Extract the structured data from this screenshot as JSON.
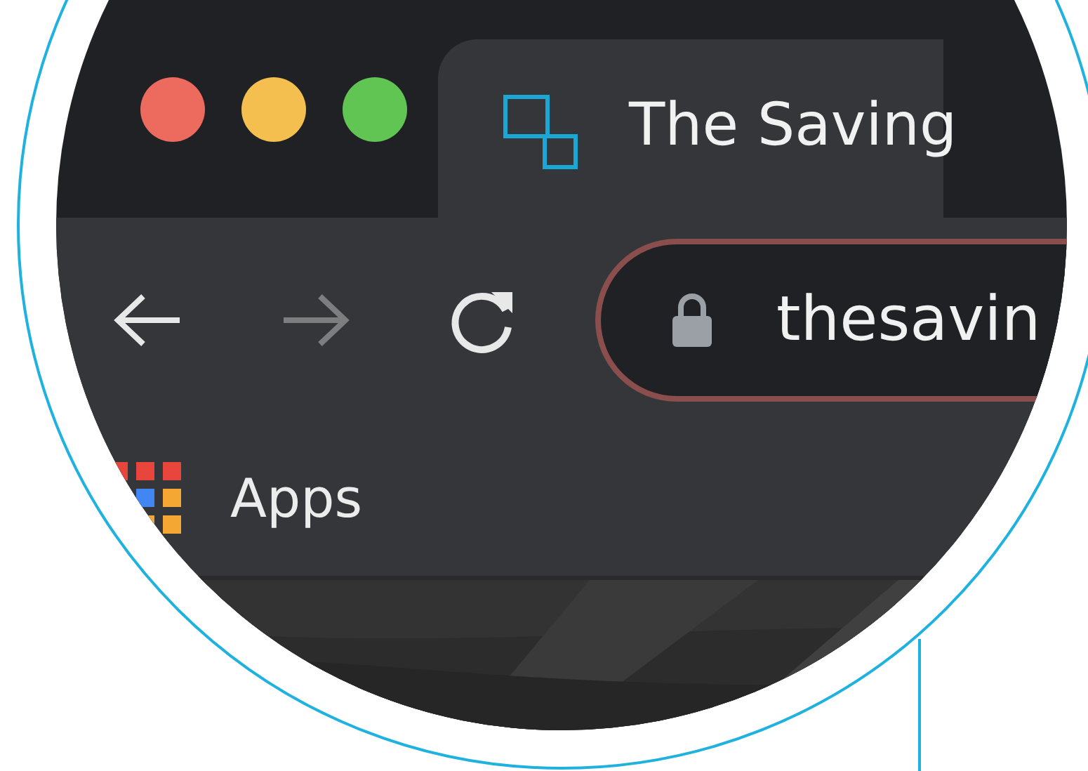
{
  "window_controls": [
    {
      "color": "#ed6a5e"
    },
    {
      "color": "#f4bf4f"
    },
    {
      "color": "#61c554"
    }
  ],
  "tabs": [
    {
      "title": "The Saving",
      "selected": true
    }
  ],
  "nav_buttons": [
    {
      "kind": "back",
      "disabled": false
    },
    {
      "kind": "forward",
      "disabled": true
    },
    {
      "kind": "reload",
      "disabled": false
    }
  ],
  "address_bar": {
    "value": "thesavin",
    "secure": true
  },
  "bookmarks": [
    {
      "kind": "apps",
      "label": "Apps"
    }
  ]
}
